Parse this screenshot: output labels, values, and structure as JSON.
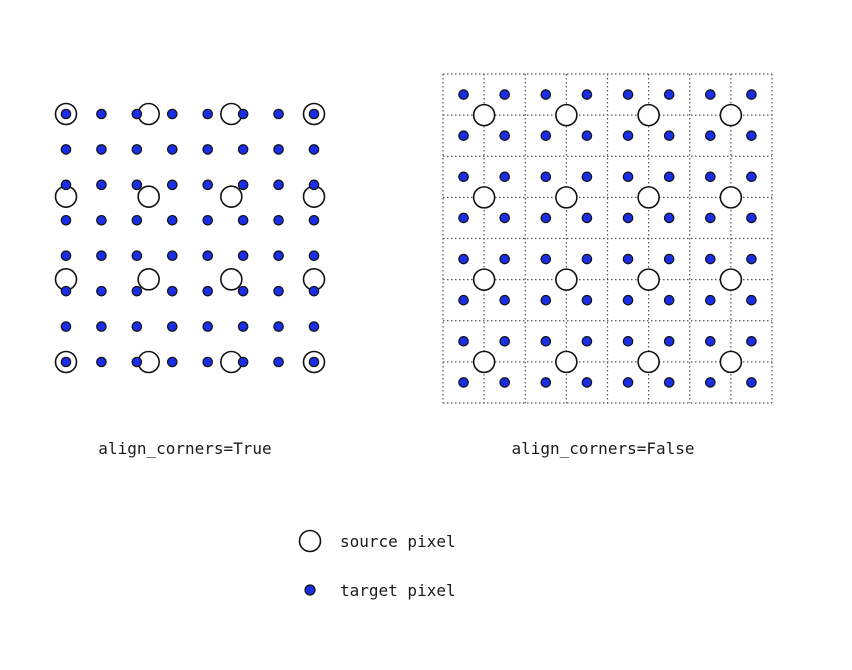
{
  "panels": [
    {
      "caption": "align_corners=True",
      "mode": "align_corners_true",
      "source_grid": [
        4,
        4
      ],
      "target_grid": [
        8,
        8
      ],
      "show_pixel_grid": false
    },
    {
      "caption": "align_corners=False",
      "mode": "align_corners_false",
      "source_grid": [
        4,
        4
      ],
      "target_grid": [
        8,
        8
      ],
      "show_pixel_grid": true
    }
  ],
  "legend": {
    "source_label": "source pixel",
    "target_label": "target pixel",
    "source_icon": "hollow-circle-icon",
    "target_icon": "filled-dot-icon"
  },
  "colors": {
    "target_fill": "#1a2ee6",
    "outline": "#111111",
    "grid_line": "#555555",
    "background": "#ffffff"
  }
}
